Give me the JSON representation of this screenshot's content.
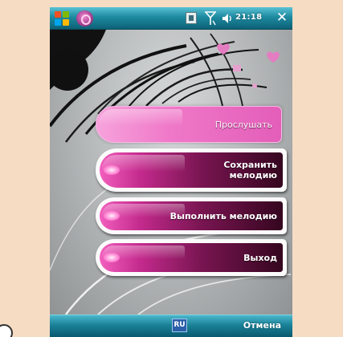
{
  "status_bar": {
    "icons": [
      "start-icon",
      "app-icon",
      "sim-icon",
      "signal-icon",
      "volume-icon"
    ],
    "time": "21:18",
    "close_glyph": "✕"
  },
  "menu": {
    "items": [
      {
        "label": "Прослушать",
        "selected": true
      },
      {
        "label": "Сохранить мелодию",
        "selected": false
      },
      {
        "label": "Выполнить мелодию",
        "selected": false
      },
      {
        "label": "Выход",
        "selected": false
      }
    ]
  },
  "softkeys": {
    "language": "RU",
    "right": "Отмена"
  },
  "colors": {
    "title_bar": "#1e8aa0",
    "accent_pink": "#e35eb9",
    "button_dark": "#35061f",
    "page_background": "#f7dcc4"
  }
}
